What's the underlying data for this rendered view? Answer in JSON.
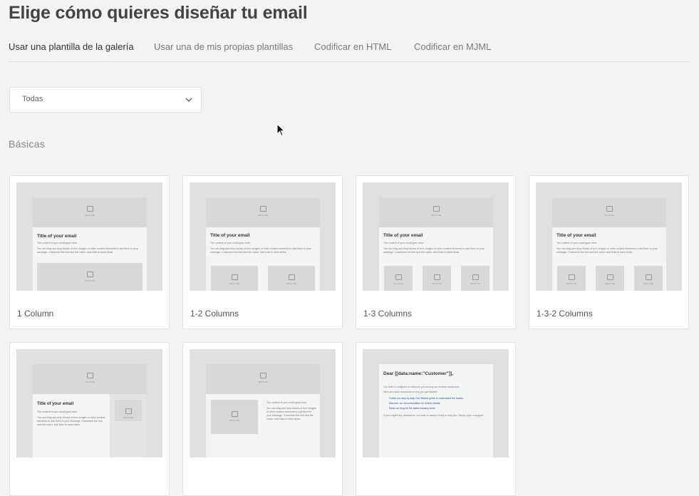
{
  "page": {
    "title": "Elige cómo quieres diseñar tu email"
  },
  "tabs": [
    {
      "label": "Usar una plantilla de la galería"
    },
    {
      "label": "Usar una de mis propias plantillas"
    },
    {
      "label": "Codificar en HTML"
    },
    {
      "label": "Codificar en MJML"
    }
  ],
  "filter": {
    "value": "Todas"
  },
  "section_title": "Básicas",
  "templates": [
    {
      "name": "1 Column"
    },
    {
      "name": "1-2 Columns"
    },
    {
      "name": "1-3 Columns"
    },
    {
      "name": "1-3-2 Columns"
    },
    {
      "name": ""
    },
    {
      "name": ""
    },
    {
      "name": ""
    }
  ],
  "preview": {
    "image_caption": "DROP ME",
    "heading": "Title of your email",
    "line_1": "The content of your email goes here.",
    "line_2": "You can drag and drop blocks of text, images or other content elements to add them to your message. Customize the font and the colors. Add links to track clicks.",
    "dear": "Dear [[data:name:\"Customer\"]],",
    "dear_line_1": "Our team is delighted to welcome you among our newest customers!",
    "dear_line_2": "Here are some resources to help you get started:",
    "dear_bullet_1": "Follow our step-by-step Get Started guide to understand the basics",
    "dear_bullet_2": "Discover our Documentation for further details",
    "dear_bullet_3": "Read our blog for the latest industry news",
    "dear_line_3": "If you require any assistance, our team is always ready to help you. Simply open a support"
  }
}
